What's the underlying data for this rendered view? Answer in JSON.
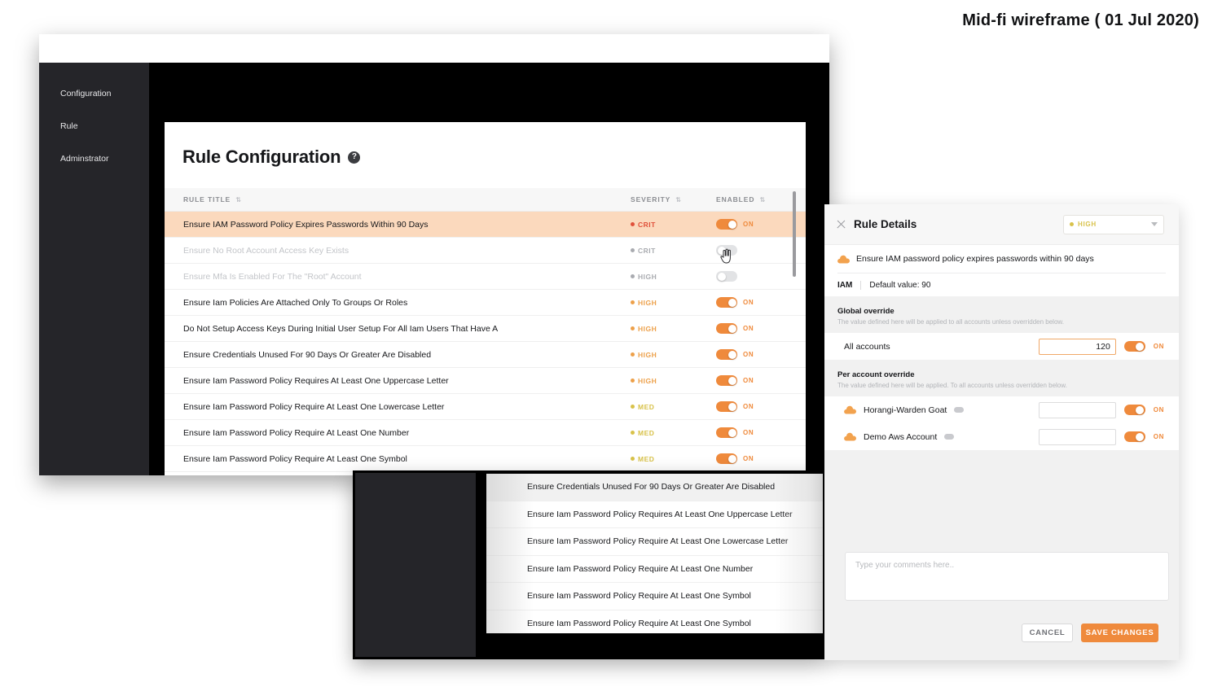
{
  "caption": "Mid-fi wireframe ( 01 Jul 2020)",
  "sidebar": {
    "items": [
      {
        "label": "Configuration"
      },
      {
        "label": "Rule"
      },
      {
        "label": "Adminstrator"
      }
    ]
  },
  "page": {
    "title": "Rule Configuration",
    "help_icon": "?"
  },
  "table": {
    "headers": {
      "title": "RULE TITLE",
      "severity": "SEVERITY",
      "enabled": "ENABLED",
      "sort_glyph": "⇅"
    },
    "rows": [
      {
        "title": "Ensure IAM Password Policy Expires Passwords Within 90 Days",
        "severity": "CRIT",
        "sev_class": "sev-crit",
        "enabled": true,
        "toggle_label": "ON",
        "selected": true,
        "muted": false
      },
      {
        "title": "Ensure No Root Account Access Key Exists",
        "severity": "CRIT",
        "sev_class": "sev-off",
        "enabled": false,
        "toggle_label": "",
        "selected": false,
        "muted": true
      },
      {
        "title": "Ensure Mfa Is Enabled For The \"Root\" Account",
        "severity": "HIGH",
        "sev_class": "sev-off",
        "enabled": false,
        "toggle_label": "",
        "selected": false,
        "muted": true
      },
      {
        "title": "Ensure Iam Policies Are Attached Only To Groups Or Roles",
        "severity": "HIGH",
        "sev_class": "sev-high",
        "enabled": true,
        "toggle_label": "ON",
        "selected": false,
        "muted": false
      },
      {
        "title": "Do Not Setup Access Keys During Initial User Setup For All Iam Users That Have A",
        "severity": "HIGH",
        "sev_class": "sev-high",
        "enabled": true,
        "toggle_label": "ON",
        "selected": false,
        "muted": false
      },
      {
        "title": "Ensure Credentials Unused For 90 Days Or Greater Are Disabled",
        "severity": "HIGH",
        "sev_class": "sev-high",
        "enabled": true,
        "toggle_label": "ON",
        "selected": false,
        "muted": false
      },
      {
        "title": "Ensure Iam Password Policy Requires At Least One Uppercase Letter",
        "severity": "HIGH",
        "sev_class": "sev-high",
        "enabled": true,
        "toggle_label": "ON",
        "selected": false,
        "muted": false
      },
      {
        "title": "Ensure Iam Password Policy Require At Least One Lowercase Letter",
        "severity": "MED",
        "sev_class": "sev-med",
        "enabled": true,
        "toggle_label": "ON",
        "selected": false,
        "muted": false
      },
      {
        "title": "Ensure Iam Password Policy Require At Least One Number",
        "severity": "MED",
        "sev_class": "sev-med",
        "enabled": true,
        "toggle_label": "ON",
        "selected": false,
        "muted": false
      },
      {
        "title": "Ensure Iam Password Policy Require At Least One Symbol",
        "severity": "MED",
        "sev_class": "sev-med",
        "enabled": true,
        "toggle_label": "ON",
        "selected": false,
        "muted": false
      },
      {
        "title": "Ensure Iam Password Policy Require At Least One Symbol",
        "severity": "MED",
        "sev_class": "sev-med",
        "enabled": true,
        "toggle_label": "ON",
        "selected": false,
        "muted": false
      }
    ]
  },
  "zoom_panel": {
    "rows": [
      {
        "title": "Ensure Credentials Unused For 90 Days Or Greater Are Disabled"
      },
      {
        "title": "Ensure Iam Password Policy Requires At Least One Uppercase Letter"
      },
      {
        "title": "Ensure Iam Password Policy Require At Least One Lowercase Letter"
      },
      {
        "title": "Ensure Iam Password Policy Require At Least One Number"
      },
      {
        "title": "Ensure Iam Password Policy Require At Least One Symbol"
      },
      {
        "title": "Ensure Iam Password Policy Require At Least One Symbol"
      }
    ]
  },
  "details": {
    "title": "Rule Details",
    "severity_select": {
      "value": "HIGH"
    },
    "rule_name": "Ensure IAM password policy expires passwords within 90 days",
    "meta": {
      "service": "IAM",
      "default_value": "Default value: 90"
    },
    "global_override": {
      "title": "Global override",
      "subtitle": "The value defined here will be applied to all accounts unless overridden below.",
      "row": {
        "name": "All accounts",
        "value": "120",
        "toggle_label": "ON",
        "enabled": true
      }
    },
    "per_account_override": {
      "title": "Per account override",
      "subtitle": "The value defined here will be applied. To all accounts unless overridden below.",
      "rows": [
        {
          "name": "Horangi-Warden Goat",
          "value": "",
          "toggle_label": "ON",
          "enabled": true
        },
        {
          "name": "Demo Aws Account",
          "value": "",
          "toggle_label": "ON",
          "enabled": true
        }
      ]
    },
    "comments": {
      "placeholder": "Type your comments here.."
    },
    "footer": {
      "cancel": "CANCEL",
      "save": "SAVE CHANGES"
    }
  },
  "colors": {
    "accent": "#ef8a3c",
    "crit": "#e0503a",
    "high": "#eda04a",
    "med": "#d8c24a",
    "selected_row": "#fbd9bd",
    "sidebar_bg": "#252529"
  }
}
